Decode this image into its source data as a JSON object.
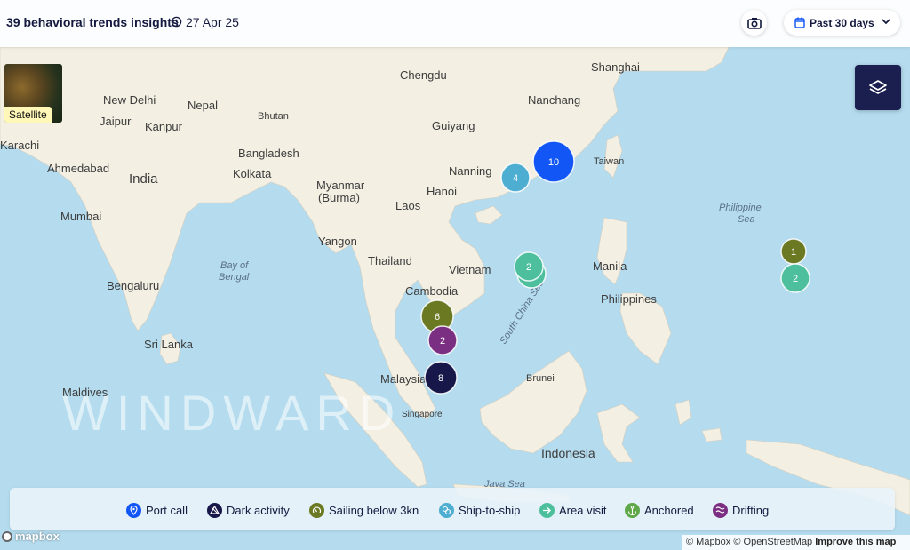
{
  "header": {
    "title": "39 behavioral trends insights",
    "date": "27 Apr 25",
    "period_label": "Past 30 days"
  },
  "satellite_toggle": {
    "label": "Satellite"
  },
  "watermark": "WINDWARD",
  "map_labels": {
    "countries": [
      "India",
      "Myanmar",
      "(Burma)",
      "Thailand",
      "Vietnam",
      "Laos",
      "Cambodia",
      "Bangladesh",
      "Nepal",
      "Bhutan",
      "Sri Lanka",
      "Maldives",
      "Malaysia",
      "Philippines",
      "Brunei",
      "Indonesia"
    ],
    "cities": [
      "Chengdu",
      "Shanghai",
      "Nanchang",
      "Guiyang",
      "Nanning",
      "Hanoi",
      "Taiwan",
      "New Delhi",
      "Jaipur",
      "Kanpur",
      "Karachi",
      "Ahmedabad",
      "Mumbai",
      "Kolkata",
      "Bengaluru",
      "Yangon",
      "Manila",
      "Singapore"
    ],
    "seas": [
      "Bay of",
      "Bengal",
      "South China Sea",
      "Philippine",
      "Sea",
      "Java Sea"
    ]
  },
  "clusters": [
    {
      "count": "10",
      "type": "Port call",
      "color": "#1256f5"
    },
    {
      "count": "4",
      "type": "Ship-to-ship",
      "color": "#4daed2"
    },
    {
      "count": "2",
      "type": "Area visit",
      "color": "#4dbf9d"
    },
    {
      "count": "2",
      "type": "Area visit",
      "color": "#4dbf9d"
    },
    {
      "count": "6",
      "type": "Sailing below 3kn",
      "color": "#6b7a22"
    },
    {
      "count": "2",
      "type": "Drifting",
      "color": "#7b2f83"
    },
    {
      "count": "8",
      "type": "Dark activity",
      "color": "#17174a"
    },
    {
      "count": "1",
      "type": "Sailing below 3kn",
      "color": "#6b7a22"
    },
    {
      "count": "2",
      "type": "Area visit",
      "color": "#4dbf9d"
    }
  ],
  "legend": [
    {
      "label": "Port call",
      "color": "#1256f5",
      "icon": "port-call-icon"
    },
    {
      "label": "Dark activity",
      "color": "#17174a",
      "icon": "dark-activity-icon"
    },
    {
      "label": "Sailing below 3kn",
      "color": "#6b7a22",
      "icon": "sailing-below-3kn-icon"
    },
    {
      "label": "Ship-to-ship",
      "color": "#4daed2",
      "icon": "ship-to-ship-icon"
    },
    {
      "label": "Area visit",
      "color": "#4dbf9d",
      "icon": "area-visit-icon"
    },
    {
      "label": "Anchored",
      "color": "#5fa84a",
      "icon": "anchor-icon"
    },
    {
      "label": "Drifting",
      "color": "#7b2f83",
      "icon": "drifting-icon"
    }
  ],
  "attribution": {
    "mapbox": "© Mapbox",
    "osm": "© OpenStreetMap",
    "improve": "Improve this map"
  },
  "logo": "mapbox",
  "colors": {
    "water": "#b4dbee",
    "land": "#f3efe3",
    "navy": "#14193f"
  }
}
